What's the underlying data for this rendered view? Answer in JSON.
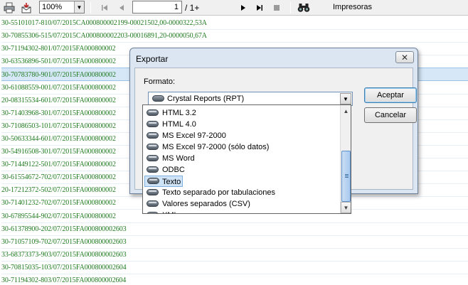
{
  "toolbar": {
    "print_icon": "printer-icon",
    "export_icon": "export-icon",
    "zoom_value": "100%",
    "page_input": "1",
    "page_total": "/ 1+",
    "find_icon": "binoculars-icon",
    "printers_label": "Impresoras"
  },
  "report_lines": [
    {
      "text": "30-55101017-810/07/2015CA000800002199-00021502,00-0000322,53A"
    },
    {
      "text": "30-70855306-515/07/2015CA000800002203-00016891,20-0000050,67A"
    },
    {
      "text": "30-71194302-801/07/2015FA000800002"
    },
    {
      "text": "30-63536896-501/07/2015FA000800002"
    },
    {
      "text": "30-70783780-901/07/2015FA000800002"
    },
    {
      "text": "30-61088559-001/07/2015FA000800002"
    },
    {
      "text": "20-08315534-601/07/2015FA000800002"
    },
    {
      "text": "30-71403968-301/07/2015FA000800002"
    },
    {
      "text": "30-71086503-101/07/2015FA000800002"
    },
    {
      "text": "30-50633344-601/07/2015FA000800002"
    },
    {
      "text": "30-54916508-301/07/2015FA000800002"
    },
    {
      "text": "30-71449122-501/07/2015FA000800002"
    },
    {
      "text": "30-61554672-702/07/2015FA000800002"
    },
    {
      "text": "20-17212372-502/07/2015FA000800002"
    },
    {
      "text": "30-71401232-702/07/2015FA000800002"
    },
    {
      "text": "30-67895544-902/07/2015FA000800002"
    },
    {
      "text": "30-61378900-202/07/2015FA000800002603"
    },
    {
      "text": "30-71057109-702/07/2015FA000800002603"
    },
    {
      "text": "33-68373373-903/07/2015FA000800002603"
    },
    {
      "text": "30-70815035-103/07/2015FA000800002604"
    },
    {
      "text": "30-71194302-803/07/2015FA000800002604"
    }
  ],
  "dialog": {
    "title": "Exportar",
    "close_label": "✕",
    "format_label": "Formato:",
    "format_selected": "Crystal Reports (RPT)",
    "accept_label": "Aceptar",
    "cancel_label": "Cancelar"
  },
  "format_options": [
    {
      "label": "HTML 3.2"
    },
    {
      "label": "HTML 4.0"
    },
    {
      "label": "MS Excel 97-2000"
    },
    {
      "label": "MS Excel 97-2000 (sólo datos)"
    },
    {
      "label": "MS Word"
    },
    {
      "label": "ODBC"
    },
    {
      "label": "Texto",
      "highlighted": true
    },
    {
      "label": "Texto separado por tabulaciones"
    },
    {
      "label": "Valores separados (CSV)"
    },
    {
      "label": "XML"
    }
  ],
  "colors": {
    "report_text": "#1f7a1f",
    "selection": "#cfe3f7",
    "dialog_frame": "#dce6f2"
  }
}
